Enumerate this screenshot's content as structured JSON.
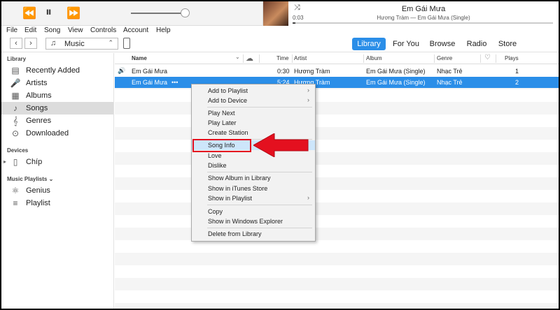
{
  "player": {
    "prev_icon": "⏪",
    "pause_icon": "⏸",
    "next_icon": "⏩",
    "shuffle_icon": "⤨",
    "now_playing_title": "Em Gái Mưa",
    "now_playing_subtitle": "Hương Tràm — Em Gái Mưa (Single)",
    "elapsed": "0:03",
    "progress_fraction": 0.01
  },
  "menubar": [
    "File",
    "Edit",
    "Song",
    "View",
    "Controls",
    "Account",
    "Help"
  ],
  "nav": {
    "back_icon": "‹",
    "forward_icon": "›",
    "media_kind": "Music",
    "note_icon": "♫",
    "select_icon": "⌃",
    "tabs": [
      "Library",
      "For You",
      "Browse",
      "Radio",
      "Store"
    ],
    "active_tab": "Library"
  },
  "sidebar": {
    "library_header": "Library",
    "library_items": [
      {
        "label": "Recently Added",
        "icon": "▤"
      },
      {
        "label": "Artists",
        "icon": "🎤"
      },
      {
        "label": "Albums",
        "icon": "▦"
      },
      {
        "label": "Songs",
        "icon": "♪"
      },
      {
        "label": "Genres",
        "icon": "𝄞"
      },
      {
        "label": "Downloaded",
        "icon": "⊙"
      }
    ],
    "selected": "Songs",
    "devices_header": "Devices",
    "device_item": "Chíp",
    "device_icon": "▯",
    "device_disclosure": "▸",
    "playlists_header": "Music Playlists ⌄",
    "playlist_items": [
      {
        "label": "Genius",
        "icon": "⚛"
      },
      {
        "label": "Playlist",
        "icon": "≡"
      }
    ]
  },
  "columns": {
    "name": "Name",
    "sort_icon": "⌄",
    "cloud_icon": "☁",
    "time": "Time",
    "artist": "Artist",
    "album": "Album",
    "genre": "Genre",
    "heart_icon": "♡",
    "plays": "Plays"
  },
  "songs": [
    {
      "name": "Em Gái Mưa",
      "time": "0:30",
      "artist": "Hương Tràm",
      "album": "Em Gái Mưa (Single)",
      "genre": "Nhạc Trẻ",
      "plays": "1",
      "playing": true,
      "speaker_icon": "🔊"
    },
    {
      "name": "Em Gái Mưa",
      "more": "•••",
      "time": "5:24",
      "artist": "Hương Tràm",
      "album": "Em Gái Mưa (Single)",
      "genre": "Nhạc Trẻ",
      "plays": "2",
      "selected": true
    }
  ],
  "context_menu": {
    "submenu_icon": "›",
    "items": [
      "Add to Playlist",
      "Add to Device",
      "Play Next",
      "Play Later",
      "Create Station",
      "Song Info",
      "Love",
      "Dislike",
      "Show Album in Library",
      "Show in iTunes Store",
      "Show in Playlist",
      "Copy",
      "Show in Windows Explorer",
      "Delete from Library"
    ],
    "highlighted": "Song Info"
  },
  "colors": {
    "accent": "#2b8ee8",
    "highlight_box": "#e4101f",
    "arrow": "#e4101f"
  }
}
